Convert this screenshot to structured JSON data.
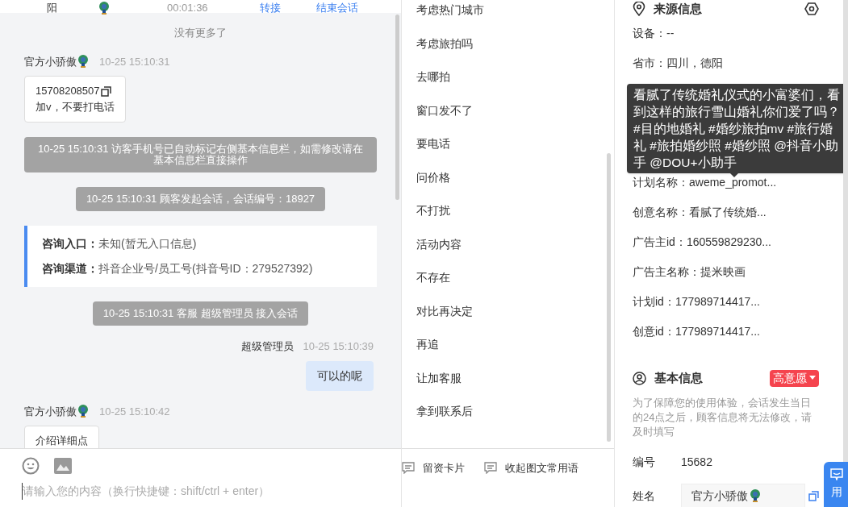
{
  "top_row": {
    "name": "阳",
    "duration": "00:01:36",
    "actions": [
      "转接",
      "结束会话"
    ]
  },
  "chat": {
    "no_more": "没有更多了",
    "messages": [
      {
        "kind": "visitor",
        "sender": "官方小骄傲",
        "time": "10-25 15:10:31",
        "lines": [
          "15708208507",
          "加v，不要打电话"
        ]
      },
      {
        "kind": "system",
        "text": "10-25 15:10:31 访客手机号已自动标记右侧基本信息栏，如需修改请在基本信息栏直接操作"
      },
      {
        "kind": "system",
        "text": "10-25 15:10:31 顾客发起会话，会话编号：18927"
      },
      {
        "kind": "info",
        "rows": [
          {
            "label": "咨询入口：",
            "value": "未知(暂无入口信息)"
          },
          {
            "label": "咨询渠道：",
            "value": "抖音企业号/员工号(抖音号ID：279527392)"
          }
        ]
      },
      {
        "kind": "system",
        "text": "10-25 15:10:31 客服 超级管理员 接入会话"
      },
      {
        "kind": "agent",
        "sender": "超级管理员",
        "time": "10-25 15:10:39",
        "lines": [
          "可以的呢"
        ]
      },
      {
        "kind": "visitor",
        "sender": "官方小骄傲",
        "time": "10-25 15:10:42",
        "lines": [
          "介绍详细点"
        ]
      }
    ]
  },
  "input": {
    "placeholder": "请输入您的内容（换行快捷键：shift/ctrl + enter）"
  },
  "phrases": {
    "items": [
      "考虑热门城市",
      "考虑旅拍吗",
      "去哪拍",
      "窗口发不了",
      "要电话",
      "问价格",
      "不打扰",
      "活动内容",
      "不存在",
      "对比再决定",
      "再追",
      "让加客服",
      "拿到联系后"
    ],
    "actions": [
      "留资卡片",
      "收起图文常用语"
    ]
  },
  "source_info": {
    "title": "来源信息",
    "rows": [
      "设备：--",
      "省市：四川，德阳",
      "计划名称：aweme_promot...",
      "创意名称：看腻了传统婚...",
      "广告主id：160559829230...",
      "广告主名称：提米映画",
      "计划id：177989714417...",
      "创意id：177989714417..."
    ],
    "tooltip": "看腻了传统婚礼仪式的小富婆们，看到这样的旅行雪山婚礼你们爱了吗？#目的地婚礼 #婚纱旅拍mv #旅行婚礼 #旅拍婚纱照 #婚纱照 @抖音小助手 @DOU+小助手"
  },
  "basic_info": {
    "title": "基本信息",
    "intent": "高意愿",
    "notice": "为了保障您的使用体验，会话发生当日的24点之后，顾客信息将无法修改，请及时填写",
    "fields": [
      {
        "label": "编号",
        "value": "15682"
      },
      {
        "label": "姓名",
        "value": "官方小骄傲"
      }
    ]
  },
  "float_button": {
    "label": "用"
  }
}
